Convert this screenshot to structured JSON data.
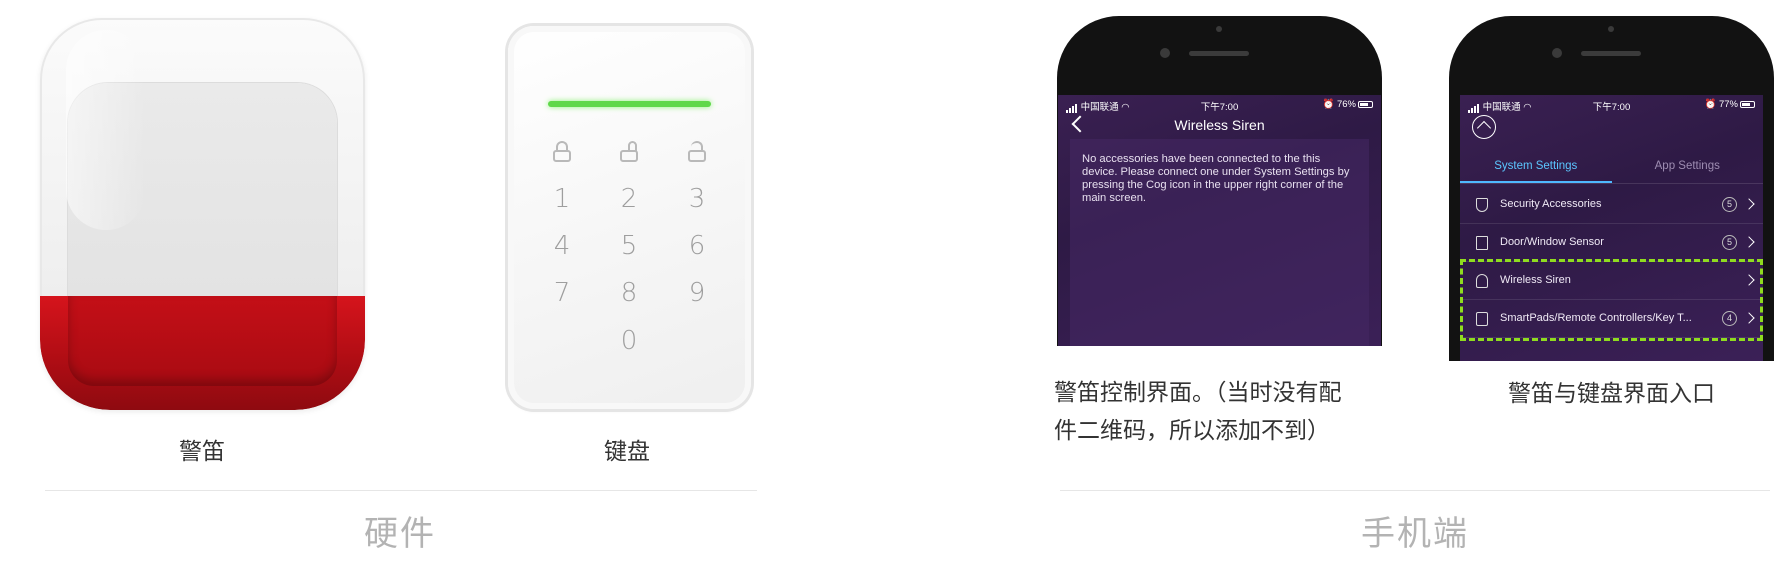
{
  "hardware": {
    "section_title": "硬件",
    "siren_caption": "警笛",
    "keypad_caption": "键盘",
    "keypad_keys": [
      "1",
      "2",
      "3",
      "4",
      "5",
      "6",
      "7",
      "8",
      "9",
      "0"
    ]
  },
  "mobile": {
    "section_title": "手机端",
    "phone1": {
      "status_left": "中国联通",
      "status_time": "下午7:00",
      "status_right": "76%",
      "battery_level": 0.76,
      "nav_title": "Wireless Siren",
      "message": "No accessories have been connected to the this device. Please connect one under System Settings by pressing the Cog icon in the upper right corner of the main screen.",
      "caption_line1": "警笛控制界面。（当时没有配",
      "caption_line2": "件二维码，所以添加不到）"
    },
    "phone2": {
      "status_left": "中国联通",
      "status_time": "下午7:00",
      "status_right": "77%",
      "battery_level": 0.77,
      "tabs": [
        "System Settings",
        "App Settings"
      ],
      "active_tab": "System Settings",
      "rows": [
        {
          "label": "Security Accessories",
          "count": "5",
          "icon": "shield-icon"
        },
        {
          "label": "Door/Window Sensor",
          "count": "5",
          "icon": "door-icon"
        },
        {
          "label": "Wireless Siren",
          "count": "",
          "icon": "bell-icon"
        },
        {
          "label": "SmartPads/Remote Controllers/Key T...",
          "count": "4",
          "icon": "remote-icon"
        }
      ],
      "highlight_color": "#8fdc1f",
      "caption": "警笛与键盘界面入口"
    }
  },
  "colors": {
    "siren_red": "#c40f17",
    "keypad_led": "#5fd84a",
    "app_background": "#2e1a45",
    "active_tab": "#5bc6ff"
  }
}
